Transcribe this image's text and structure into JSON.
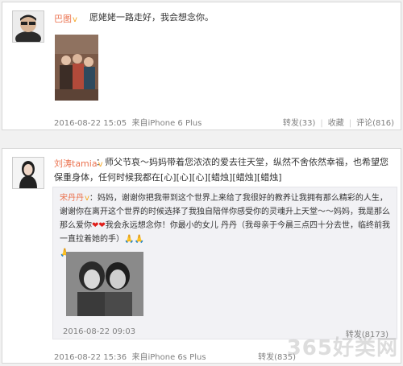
{
  "post1": {
    "user": "巴图",
    "vip_badge": "v",
    "text": "愿姥姥一路走好，我会想念你。",
    "time": "2016-08-22 15:05",
    "source": "来自iPhone 6 Plus",
    "actions": {
      "forward": "转发(33)",
      "favorite": "收藏",
      "comment": "评论(816)"
    }
  },
  "post2": {
    "user": "刘涛tamia",
    "vip_badge": "v",
    "text": "：师父节哀～妈妈带着您浓浓的爱去往天堂，纵然不舍依然幸福，也希望您保重身体，任何时候我都在[心][心][心][蜡烛][蜡烛][蜡烛]",
    "quote": {
      "user": "宋丹丹",
      "vip_badge": "v",
      "text": "：妈妈，谢谢你把我带到这个世界上来给了我很好的教养让我拥有那么精彩的人生，谢谢你在离开这个世界的时候选择了我独自陪伴你感受你的灵魂升上天堂～～妈妈，我是那么那么爱你",
      "text2": "我会永远想念你！你最小的女儿 丹丹（我母亲于今晨三点四十分去世，临终前我一直拉着她的手）",
      "time": "2016-08-22 09:03",
      "actions": "转发(8173)"
    },
    "time": "2016-08-22 15:36",
    "source": "来自iPhone 6s Plus",
    "actions": {
      "forward": "转发(835)"
    }
  },
  "watermark": "365好类网"
}
